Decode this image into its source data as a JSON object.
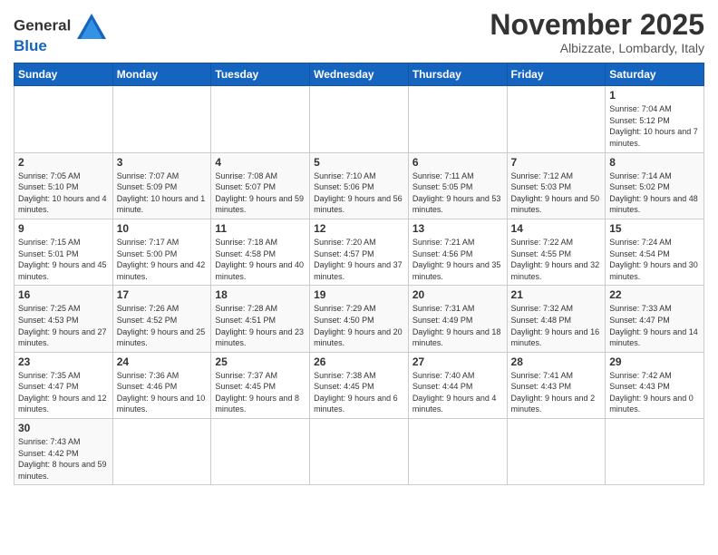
{
  "logo": {
    "line1": "General",
    "line2": "Blue"
  },
  "title": "November 2025",
  "subtitle": "Albizzate, Lombardy, Italy",
  "weekdays": [
    "Sunday",
    "Monday",
    "Tuesday",
    "Wednesday",
    "Thursday",
    "Friday",
    "Saturday"
  ],
  "weeks": [
    [
      {
        "day": "",
        "info": ""
      },
      {
        "day": "",
        "info": ""
      },
      {
        "day": "",
        "info": ""
      },
      {
        "day": "",
        "info": ""
      },
      {
        "day": "",
        "info": ""
      },
      {
        "day": "",
        "info": ""
      },
      {
        "day": "1",
        "info": "Sunrise: 7:04 AM\nSunset: 5:12 PM\nDaylight: 10 hours and 7 minutes."
      }
    ],
    [
      {
        "day": "2",
        "info": "Sunrise: 7:05 AM\nSunset: 5:10 PM\nDaylight: 10 hours and 4 minutes."
      },
      {
        "day": "3",
        "info": "Sunrise: 7:07 AM\nSunset: 5:09 PM\nDaylight: 10 hours and 1 minute."
      },
      {
        "day": "4",
        "info": "Sunrise: 7:08 AM\nSunset: 5:07 PM\nDaylight: 9 hours and 59 minutes."
      },
      {
        "day": "5",
        "info": "Sunrise: 7:10 AM\nSunset: 5:06 PM\nDaylight: 9 hours and 56 minutes."
      },
      {
        "day": "6",
        "info": "Sunrise: 7:11 AM\nSunset: 5:05 PM\nDaylight: 9 hours and 53 minutes."
      },
      {
        "day": "7",
        "info": "Sunrise: 7:12 AM\nSunset: 5:03 PM\nDaylight: 9 hours and 50 minutes."
      },
      {
        "day": "8",
        "info": "Sunrise: 7:14 AM\nSunset: 5:02 PM\nDaylight: 9 hours and 48 minutes."
      }
    ],
    [
      {
        "day": "9",
        "info": "Sunrise: 7:15 AM\nSunset: 5:01 PM\nDaylight: 9 hours and 45 minutes."
      },
      {
        "day": "10",
        "info": "Sunrise: 7:17 AM\nSunset: 5:00 PM\nDaylight: 9 hours and 42 minutes."
      },
      {
        "day": "11",
        "info": "Sunrise: 7:18 AM\nSunset: 4:58 PM\nDaylight: 9 hours and 40 minutes."
      },
      {
        "day": "12",
        "info": "Sunrise: 7:20 AM\nSunset: 4:57 PM\nDaylight: 9 hours and 37 minutes."
      },
      {
        "day": "13",
        "info": "Sunrise: 7:21 AM\nSunset: 4:56 PM\nDaylight: 9 hours and 35 minutes."
      },
      {
        "day": "14",
        "info": "Sunrise: 7:22 AM\nSunset: 4:55 PM\nDaylight: 9 hours and 32 minutes."
      },
      {
        "day": "15",
        "info": "Sunrise: 7:24 AM\nSunset: 4:54 PM\nDaylight: 9 hours and 30 minutes."
      }
    ],
    [
      {
        "day": "16",
        "info": "Sunrise: 7:25 AM\nSunset: 4:53 PM\nDaylight: 9 hours and 27 minutes."
      },
      {
        "day": "17",
        "info": "Sunrise: 7:26 AM\nSunset: 4:52 PM\nDaylight: 9 hours and 25 minutes."
      },
      {
        "day": "18",
        "info": "Sunrise: 7:28 AM\nSunset: 4:51 PM\nDaylight: 9 hours and 23 minutes."
      },
      {
        "day": "19",
        "info": "Sunrise: 7:29 AM\nSunset: 4:50 PM\nDaylight: 9 hours and 20 minutes."
      },
      {
        "day": "20",
        "info": "Sunrise: 7:31 AM\nSunset: 4:49 PM\nDaylight: 9 hours and 18 minutes."
      },
      {
        "day": "21",
        "info": "Sunrise: 7:32 AM\nSunset: 4:48 PM\nDaylight: 9 hours and 16 minutes."
      },
      {
        "day": "22",
        "info": "Sunrise: 7:33 AM\nSunset: 4:47 PM\nDaylight: 9 hours and 14 minutes."
      }
    ],
    [
      {
        "day": "23",
        "info": "Sunrise: 7:35 AM\nSunset: 4:47 PM\nDaylight: 9 hours and 12 minutes."
      },
      {
        "day": "24",
        "info": "Sunrise: 7:36 AM\nSunset: 4:46 PM\nDaylight: 9 hours and 10 minutes."
      },
      {
        "day": "25",
        "info": "Sunrise: 7:37 AM\nSunset: 4:45 PM\nDaylight: 9 hours and 8 minutes."
      },
      {
        "day": "26",
        "info": "Sunrise: 7:38 AM\nSunset: 4:45 PM\nDaylight: 9 hours and 6 minutes."
      },
      {
        "day": "27",
        "info": "Sunrise: 7:40 AM\nSunset: 4:44 PM\nDaylight: 9 hours and 4 minutes."
      },
      {
        "day": "28",
        "info": "Sunrise: 7:41 AM\nSunset: 4:43 PM\nDaylight: 9 hours and 2 minutes."
      },
      {
        "day": "29",
        "info": "Sunrise: 7:42 AM\nSunset: 4:43 PM\nDaylight: 9 hours and 0 minutes."
      }
    ],
    [
      {
        "day": "30",
        "info": "Sunrise: 7:43 AM\nSunset: 4:42 PM\nDaylight: 8 hours and 59 minutes."
      },
      {
        "day": "",
        "info": ""
      },
      {
        "day": "",
        "info": ""
      },
      {
        "day": "",
        "info": ""
      },
      {
        "day": "",
        "info": ""
      },
      {
        "day": "",
        "info": ""
      },
      {
        "day": "",
        "info": ""
      }
    ]
  ]
}
